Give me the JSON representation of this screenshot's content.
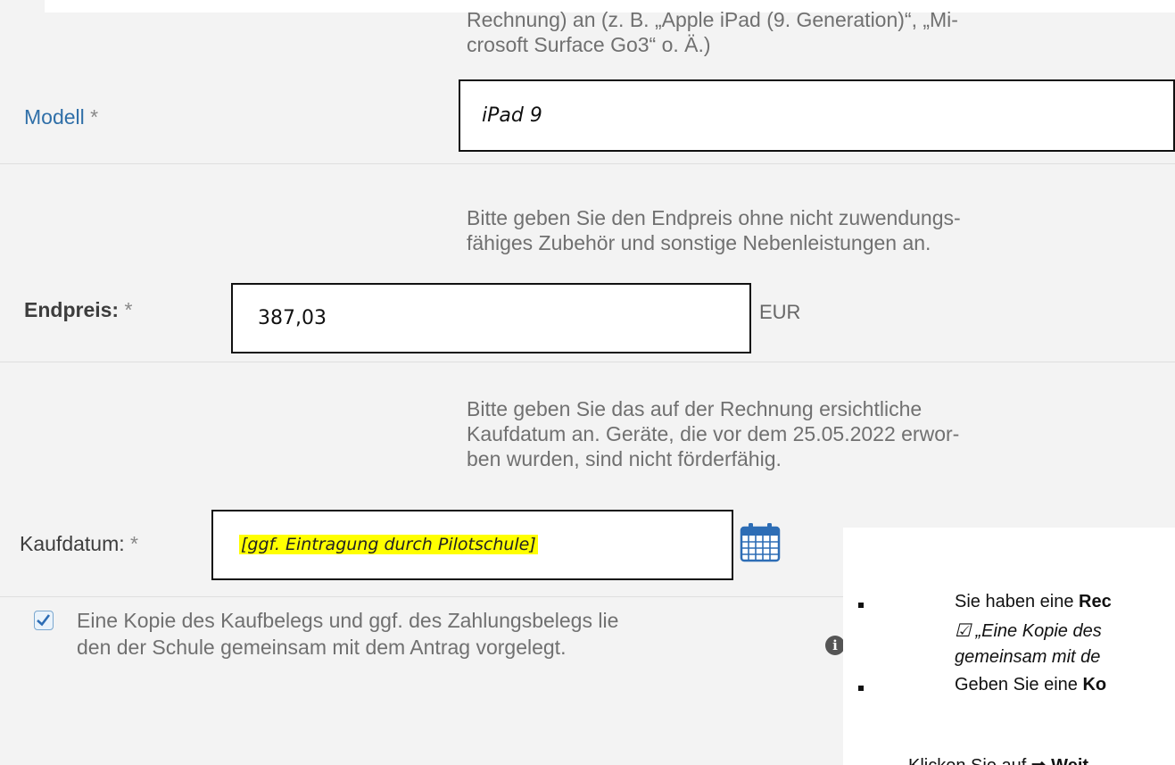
{
  "modell": {
    "help_lines": [
      "Rechnung) an (z. B. „Apple iPad (9. Generation)“, „Mi-",
      "crosoft Surface Go3“ o. Ä.)"
    ],
    "label": "Modell",
    "required_mark": "*",
    "value": "iPad 9"
  },
  "endpreis": {
    "help_lines": [
      "Bitte geben Sie den Endpreis ohne nicht zuwendungs-",
      "fähiges Zubehör und sonstige Nebenleistungen an."
    ],
    "label": "Endpreis:",
    "required_mark": "*",
    "value": "387,03",
    "unit": "EUR"
  },
  "kaufdatum": {
    "help_lines": [
      "Bitte geben Sie das auf der Rechnung ersichtliche",
      "Kaufdatum an. Geräte, die vor dem 25.05.2022 erwor-",
      "ben wurden, sind nicht förderfähig."
    ],
    "label": "Kaufdatum:",
    "required_mark": "*",
    "value": "[ggf. Eintragung durch Pilotschule]",
    "highlight_color": "#ffff00",
    "icon": "calendar-icon"
  },
  "confirmation": {
    "checked": true,
    "lines": [
      "Eine Kopie des Kaufbelegs und ggf. des Zahlungsbelegs lie",
      "den der Schule gemeinsam mit dem Antrag vorgelegt."
    ],
    "icon": "info-icon"
  },
  "overlay": {
    "bullet1_pre": "Sie haben eine ",
    "bullet1_bold": "Rec",
    "line2": "☑ „Eine Kopie des ",
    "line3": "gemeinsam mit de",
    "bullet2_pre": "Geben Sie eine ",
    "bullet2_bold": "Ko",
    "line5_pre": "Klicken Sie auf ",
    "line5_bold": "⇒ Weit"
  },
  "colors": {
    "label_blue": "#2f6fa8",
    "help_gray": "#707070",
    "calendar_blue": "#2d6db5"
  }
}
